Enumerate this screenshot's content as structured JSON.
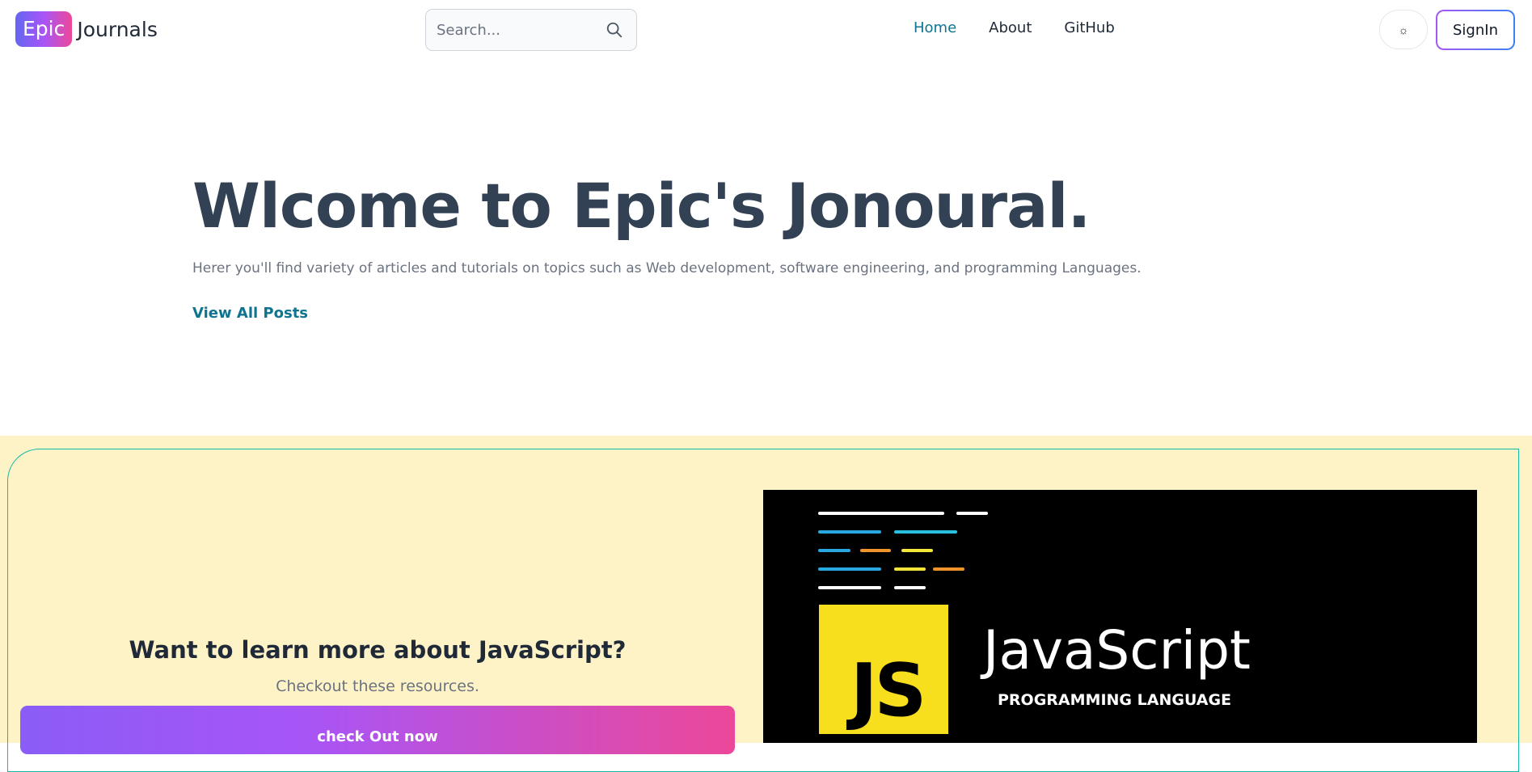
{
  "header": {
    "logo_badge": "Epic",
    "logo_text": "Journals",
    "search": {
      "placeholder": "Search..."
    },
    "nav": [
      {
        "label": "Home",
        "active": true
      },
      {
        "label": "About",
        "active": false
      },
      {
        "label": "GitHub",
        "active": false
      }
    ],
    "theme_toggle_icon": "☼",
    "signin_label": "SignIn"
  },
  "hero": {
    "title": "Wlcome to Epic's Jonoural.",
    "subtitle": "Herer you'll find variety of articles and tutorials on topics such as Web development, software engineering, and programming Languages.",
    "link_label": "View All Posts"
  },
  "promo": {
    "heading": "Want to learn more about JavaScript?",
    "subheading": "Checkout these resources.",
    "button_label": "check Out now",
    "banner": {
      "logo_letters": "JS",
      "name": "JavaScript",
      "tagline": "PROGRAMMING LANGUAGE"
    }
  },
  "colors": {
    "accent": "#0e7490",
    "promo_background": "#fef3c7",
    "js_yellow": "#f7df1e"
  }
}
